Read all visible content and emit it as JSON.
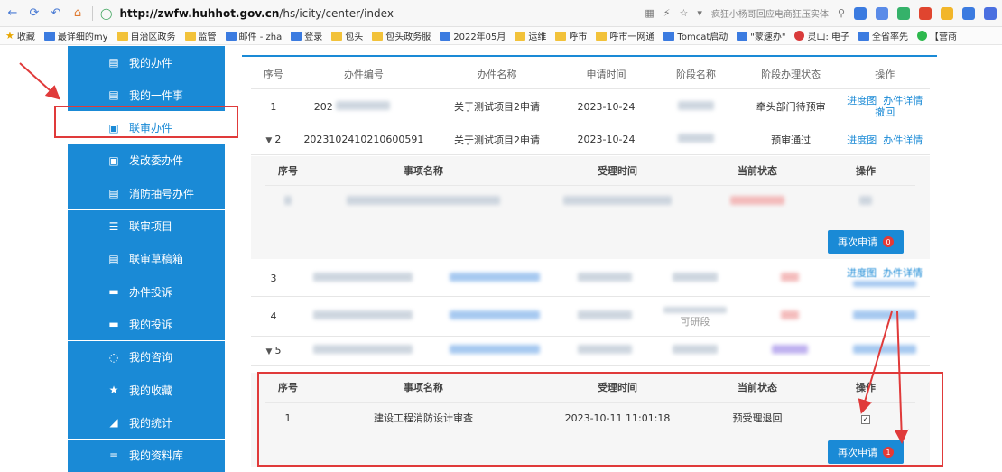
{
  "browser": {
    "url_host": "http://zwfw.huhhot.gov.cn",
    "url_path": "/hs/icity/center/index",
    "news_snippet": "疯狂小杨哥回应电商狂压实体",
    "bookmarks": [
      {
        "label": "收藏",
        "kind": "star"
      },
      {
        "label": "最详细的my",
        "kind": "blue"
      },
      {
        "label": "自治区政务",
        "kind": "folder"
      },
      {
        "label": "监管",
        "kind": "folder"
      },
      {
        "label": "邮件 - zha",
        "kind": "blue"
      },
      {
        "label": "登录",
        "kind": "blue"
      },
      {
        "label": "包头",
        "kind": "folder"
      },
      {
        "label": "包头政务服",
        "kind": "folder"
      },
      {
        "label": "2022年05月",
        "kind": "blue"
      },
      {
        "label": "运维",
        "kind": "folder"
      },
      {
        "label": "呼市",
        "kind": "folder"
      },
      {
        "label": "呼市一网通",
        "kind": "folder"
      },
      {
        "label": "Tomcat启动",
        "kind": "blue"
      },
      {
        "label": "\"蒙速办\"",
        "kind": "blue"
      },
      {
        "label": "灵山: 电子",
        "kind": "red"
      },
      {
        "label": "全省率先",
        "kind": "blue"
      },
      {
        "label": "【营商",
        "kind": "green"
      }
    ]
  },
  "sidebar": {
    "items": [
      {
        "label": "我的办件",
        "icon": "document-icon"
      },
      {
        "label": "我的一件事",
        "icon": "document-icon"
      },
      {
        "label": "联审办件",
        "icon": "card-icon"
      },
      {
        "label": "发改委办件",
        "icon": "card-icon"
      },
      {
        "label": "消防抽号办件",
        "icon": "document-icon"
      },
      {
        "label": "联审项目",
        "icon": "list-icon"
      },
      {
        "label": "联审草稿箱",
        "icon": "document-icon"
      },
      {
        "label": "办件投诉",
        "icon": "chat-icon"
      },
      {
        "label": "我的投诉",
        "icon": "chat-icon"
      },
      {
        "label": "我的咨询",
        "icon": "consult-icon"
      },
      {
        "label": "我的收藏",
        "icon": "star-icon"
      },
      {
        "label": "我的统计",
        "icon": "chart-icon"
      },
      {
        "label": "我的资料库",
        "icon": "database-icon"
      }
    ],
    "active_index": 2
  },
  "main_table": {
    "headers": [
      "序号",
      "办件编号",
      "办件名称",
      "申请时间",
      "阶段名称",
      "阶段办理状态",
      "操作"
    ],
    "row1": {
      "index": "1",
      "code": "202",
      "name": "关于测试项目2申请",
      "date": "2023-10-24",
      "status": "牵头部门待预审",
      "op1": "进度图",
      "op2": "办件详情",
      "op3": "撤回"
    },
    "row2": {
      "index": "2",
      "code": "2023102410210600591",
      "name": "关于测试项目2申请",
      "date": "2023-10-24",
      "status": "预审通过",
      "op1": "进度图",
      "op2": "办件详情"
    },
    "row3": {
      "index": "3",
      "op1": "进度图",
      "op2": "办件详情"
    },
    "row4": {
      "index": "4",
      "stage": "可研段"
    },
    "row5": {
      "index": "5"
    }
  },
  "sub_table": {
    "headers": [
      "序号",
      "事项名称",
      "受理时间",
      "当前状态",
      "操作"
    ]
  },
  "sub_table_2": {
    "row": {
      "index": "1",
      "name": "建设工程消防设计审查",
      "time": "2023-10-11 11:01:18",
      "status": "预受理退回"
    }
  },
  "reapply": {
    "label": "再次申请",
    "badge_top": "0",
    "badge_bottom": "1"
  },
  "colors": {
    "primary": "#1a8ad6",
    "highlight_red": "#e03a3a"
  }
}
